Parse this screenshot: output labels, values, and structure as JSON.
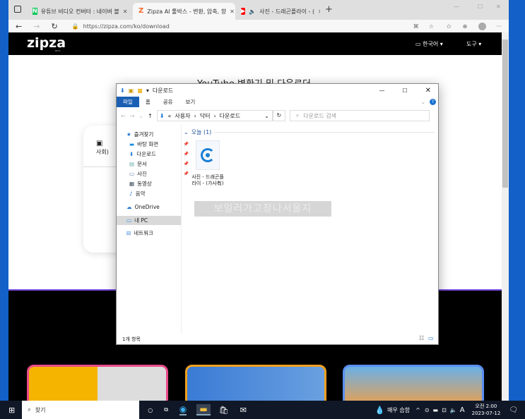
{
  "browser": {
    "tabs": [
      {
        "label": "유튜브 비디오 컨버터 : 네이버 블",
        "active": false
      },
      {
        "label": "Zipza AI 툴박스 - 변환, 압축, 향",
        "active": true
      },
      {
        "label": "사진 - 드래곤플라이 - (",
        "active": false
      }
    ],
    "url": "https://zipza.com/ko/download",
    "window_controls": [
      "—",
      "☐",
      "✕"
    ]
  },
  "site": {
    "logo": "zipza",
    "logo_badge": "BETA",
    "language": "한국어",
    "tools": "도구",
    "title": "YouTube 변환기 및 다운로더",
    "card_text": "사회)"
  },
  "explorer": {
    "title": "다운로드",
    "ribbon_tabs": [
      "파일",
      "홈",
      "공유",
      "보기"
    ],
    "breadcrumb": [
      "사용자",
      "닥터",
      "다운로드"
    ],
    "search_placeholder": "다운로드 검색",
    "nav": {
      "quick_access": "즐겨찾기",
      "items": [
        "바탕 화면",
        "다운로드",
        "문서",
        "사진",
        "동영상",
        "음악"
      ],
      "onedrive": "OneDrive",
      "this_pc": "내 PC",
      "network": "네트워크"
    },
    "group_header": "오늘 (1)",
    "file_name": "사진 - 드래곤플라이 - (가사有)",
    "overlay_text": "보일러가고장나서울지",
    "status": "1개 항목"
  },
  "taskbar": {
    "search": "찾기",
    "weather": "매우 습함",
    "ime": "A",
    "time": "오전 2:00",
    "date": "2023-07-12"
  }
}
